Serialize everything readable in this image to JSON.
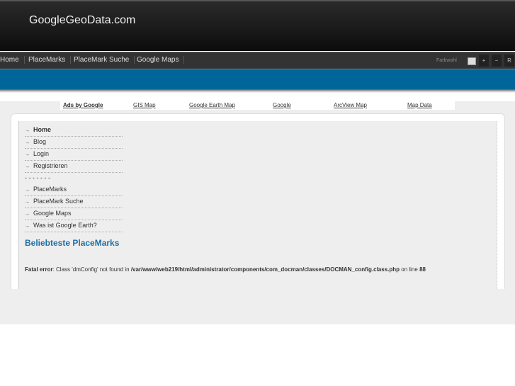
{
  "site_title": "GoogleGeoData.com",
  "nav": [
    "Home",
    "PlaceMarks",
    "PlaceMark Suche",
    "Google Maps"
  ],
  "toolbar": {
    "farbwahl": "Farbwahl",
    "plus": "+",
    "minus": "−",
    "reset": "R"
  },
  "ads": {
    "label": "Ads by Google",
    "links": [
      "GIS Map",
      "Google Earth Map",
      "Google",
      "ArcView Map",
      "Map Data"
    ]
  },
  "menu": {
    "items_top": [
      "Home",
      "Blog",
      "Login",
      "Registrieren"
    ],
    "separator": "- - - - - - -",
    "items_bottom": [
      "PlaceMarks",
      "PlaceMark Suche",
      "Google Maps",
      "Was ist Google Earth?"
    ]
  },
  "heading": "Beliebteste PlaceMarks",
  "error": {
    "label": "Fatal error",
    "msg1": ": Class 'dmConfig' not found in ",
    "path": "/var/www/web219/html/administrator/components/com_docman/classes/DOCMAN_config.class.php",
    "msg2": " on line ",
    "line": "88"
  }
}
